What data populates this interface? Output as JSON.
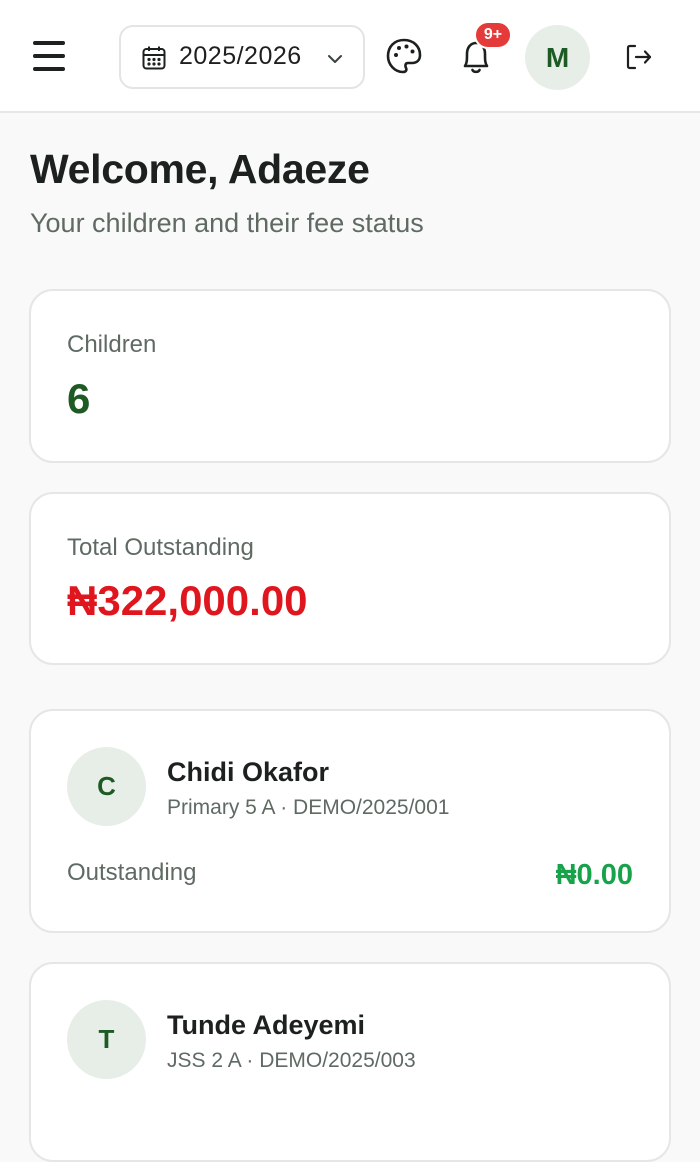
{
  "header": {
    "session_year": "2025/2026",
    "notification_badge": "9+",
    "user_initial": "M",
    "icons": [
      "menu-icon",
      "calendar-icon",
      "chevron-down-icon",
      "palette-icon",
      "bell-icon",
      "logout-icon"
    ]
  },
  "page": {
    "title": "Welcome, Adaeze",
    "subtitle": "Your children and their fee status"
  },
  "stats": {
    "children_label": "Children",
    "children_value": "6",
    "outstanding_label": "Total Outstanding",
    "outstanding_value": "₦322,000.00"
  },
  "children": [
    {
      "initial": "C",
      "name": "Chidi Okafor",
      "meta": "Primary 5 A · DEMO/2025/001",
      "outstanding_label": "Outstanding",
      "outstanding_value": "₦0.00"
    },
    {
      "initial": "T",
      "name": "Tunde Adeyemi",
      "meta": "JSS 2 A · DEMO/2025/003"
    }
  ],
  "colors": {
    "brand": "#1e5a24",
    "danger": "#e0161f",
    "success": "#17a34a",
    "badge": "#e53a3a"
  }
}
